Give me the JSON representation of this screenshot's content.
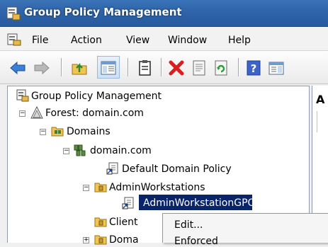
{
  "window": {
    "title": "Group Policy Management"
  },
  "menu": {
    "items": [
      "File",
      "Action",
      "View",
      "Window",
      "Help"
    ]
  },
  "toolbar": {
    "buttons": [
      "back-icon",
      "forward-icon",
      "up-folder-icon",
      "show-hide-tree-icon",
      "clipboard-icon",
      "delete-icon",
      "properties-icon",
      "refresh-icon",
      "help-icon",
      "action-pane-icon"
    ]
  },
  "tree": {
    "root": "Group Policy Management",
    "forest": "Forest: domain.com",
    "domains": "Domains",
    "domain": "domain.com",
    "default_policy": "Default Domain Policy",
    "ou_admin": "AdminWorkstations",
    "selected_gpo": "AdminWorkstationGPO",
    "ou_client": "Client",
    "ou_doma": "Doma"
  },
  "right_panel": {
    "heading": "A"
  },
  "context_menu": {
    "items": [
      "Edit...",
      "Enforced"
    ]
  },
  "colors": {
    "titlebar": "#2e63a9",
    "selection": "#0a246a",
    "delete_red": "#d81e1e"
  }
}
